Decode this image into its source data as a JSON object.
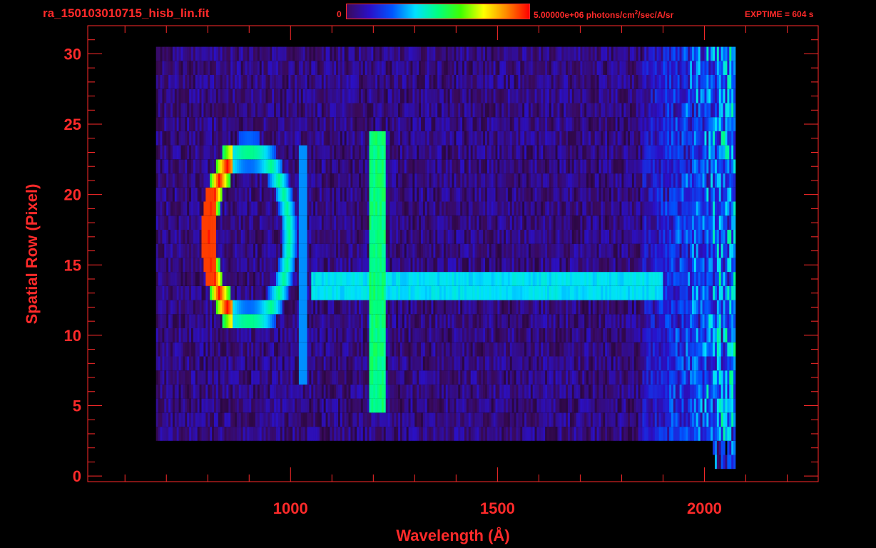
{
  "header": {
    "file_title": "ra_150103010715_hisb_lin.fit",
    "colorbar_min": "0",
    "colorbar_max_prefix": "5.00000e+06 photons/cm",
    "colorbar_max_sup": "2",
    "colorbar_max_suffix": "/sec/A/sr",
    "exptime": "EXPTIME = 604 s"
  },
  "colors": {
    "axis": "#ff2a2a",
    "background": "#000000",
    "colormap": [
      "#000000",
      "#3a0a5a",
      "#2a10c8",
      "#0055ff",
      "#00e0ff",
      "#00ff80",
      "#40ff00",
      "#ffff00",
      "#ff8800",
      "#ff0000"
    ]
  },
  "chart_data": {
    "type": "heatmap",
    "title": "ra_150103010715_hisb_lin.fit",
    "xlabel": "Wavelength (Å)",
    "ylabel": "Spatial Row (Pixel)",
    "x_ticks": [
      "1000",
      "1500",
      "2000"
    ],
    "y_ticks": [
      "0",
      "5",
      "10",
      "15",
      "20",
      "25",
      "30"
    ],
    "xlim": [
      510,
      2275
    ],
    "ylim": [
      -0.4,
      32
    ],
    "colorbar": {
      "min": 0,
      "max": 5000000,
      "unit": "photons/cm2/sec/A/sr",
      "colormap": "rainbow"
    },
    "features": [
      {
        "name": "Arc near 790-960 Å, rows 11-24",
        "peak_intensity": 1.0
      },
      {
        "name": "Lyman-alpha band near 1216 Å, rows 5-24",
        "peak_intensity": 0.6
      },
      {
        "name": "Horizontal band at row 13.5, 1050-1900 Å",
        "peak_intensity": 0.45
      },
      {
        "name": "Line near 1025 Å, rows 7-23",
        "peak_intensity": 0.4
      }
    ]
  }
}
